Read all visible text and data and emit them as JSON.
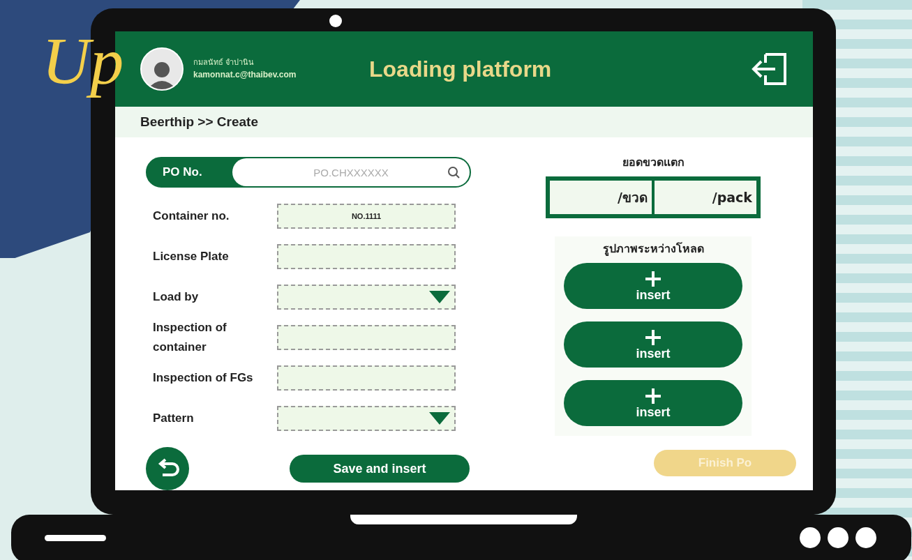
{
  "decoration": {
    "title_lines": [
      "Up"
    ]
  },
  "header": {
    "user_name": "กมลนัทธ์ จำปานิน",
    "user_email": "kamonnat.c@thaibev.com",
    "title": "Loading platform"
  },
  "breadcrumb": "Beerthip >> Create",
  "po_search": {
    "label": "PO No.",
    "placeholder": "PO.CHXXXXXX"
  },
  "fields": [
    {
      "label": "Container no.",
      "kind": "text",
      "value": "NO.1111"
    },
    {
      "label": "License Plate",
      "kind": "text"
    },
    {
      "label": "Load by",
      "kind": "dropdown"
    },
    {
      "label": "Inspection of container",
      "kind": "text"
    },
    {
      "label": "Inspection of FGs",
      "kind": "text"
    },
    {
      "label": "Pattern",
      "kind": "dropdown"
    }
  ],
  "save_button": "Save and insert",
  "broken_bottles": {
    "title": "ยอดขวดแตก",
    "units": [
      "/ขวด",
      "/pack"
    ]
  },
  "photos": {
    "title": "รูปภาพระหว่างโหลด",
    "buttons": [
      "insert",
      "insert",
      "insert"
    ]
  },
  "finish_button": {
    "label": "Finish Po",
    "disabled": true
  }
}
